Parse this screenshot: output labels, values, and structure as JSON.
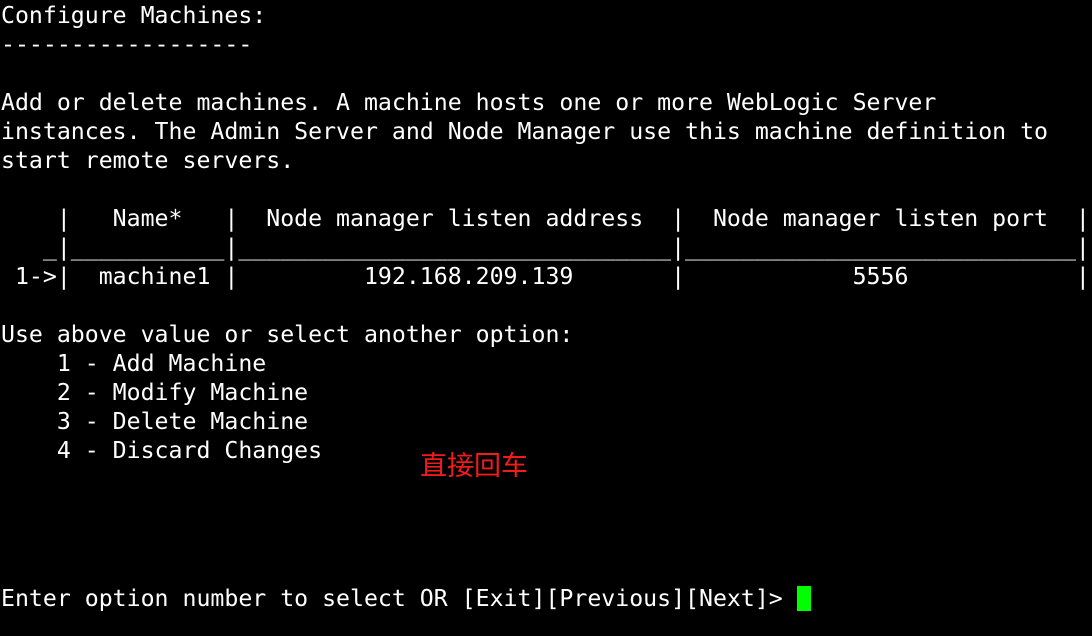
{
  "terminal": {
    "background_color": "#000000",
    "text_color": "#ffffff",
    "cursor_color": "#00ff00",
    "annotation_color": "#f21b1b",
    "screen_title": "Configure Machines:",
    "title_underline": "------------------",
    "description_line_1": "Add or delete machines. A machine hosts one or more WebLogic Server",
    "description_line_2": "instances. The Admin Server and Node Manager use this machine definition to",
    "description_line_3": "start remote servers.",
    "table": {
      "header_row": "    |   Name*   |  Node manager listen address  |  Node manager listen port  |",
      "separator_row": "   _|___________|_______________________________|____________________________|",
      "data_row": " 1->|  machine1 |         192.168.209.139       |            5556            |",
      "columns": [
        "Name*",
        "Node manager listen address",
        "Node manager listen port"
      ],
      "rows": [
        {
          "selector": "1->",
          "name": "machine1",
          "node_manager_listen_address": "192.168.209.139",
          "node_manager_listen_port": "5556"
        }
      ]
    },
    "options_heading": "Use above value or select another option:",
    "options": [
      "    1 - Add Machine",
      "    2 - Modify Machine",
      "    3 - Delete Machine",
      "    4 - Discard Changes"
    ],
    "option_items": [
      {
        "number": "1",
        "label": "Add Machine"
      },
      {
        "number": "2",
        "label": "Modify Machine"
      },
      {
        "number": "3",
        "label": "Delete Machine"
      },
      {
        "number": "4",
        "label": "Discard Changes"
      }
    ],
    "prompt_text": "Enter option number to select OR [Exit][Previous][Next]> ",
    "prompt_actions": [
      "Exit",
      "Previous",
      "Next"
    ],
    "input_value": "",
    "annotation_text": "直接回车"
  }
}
